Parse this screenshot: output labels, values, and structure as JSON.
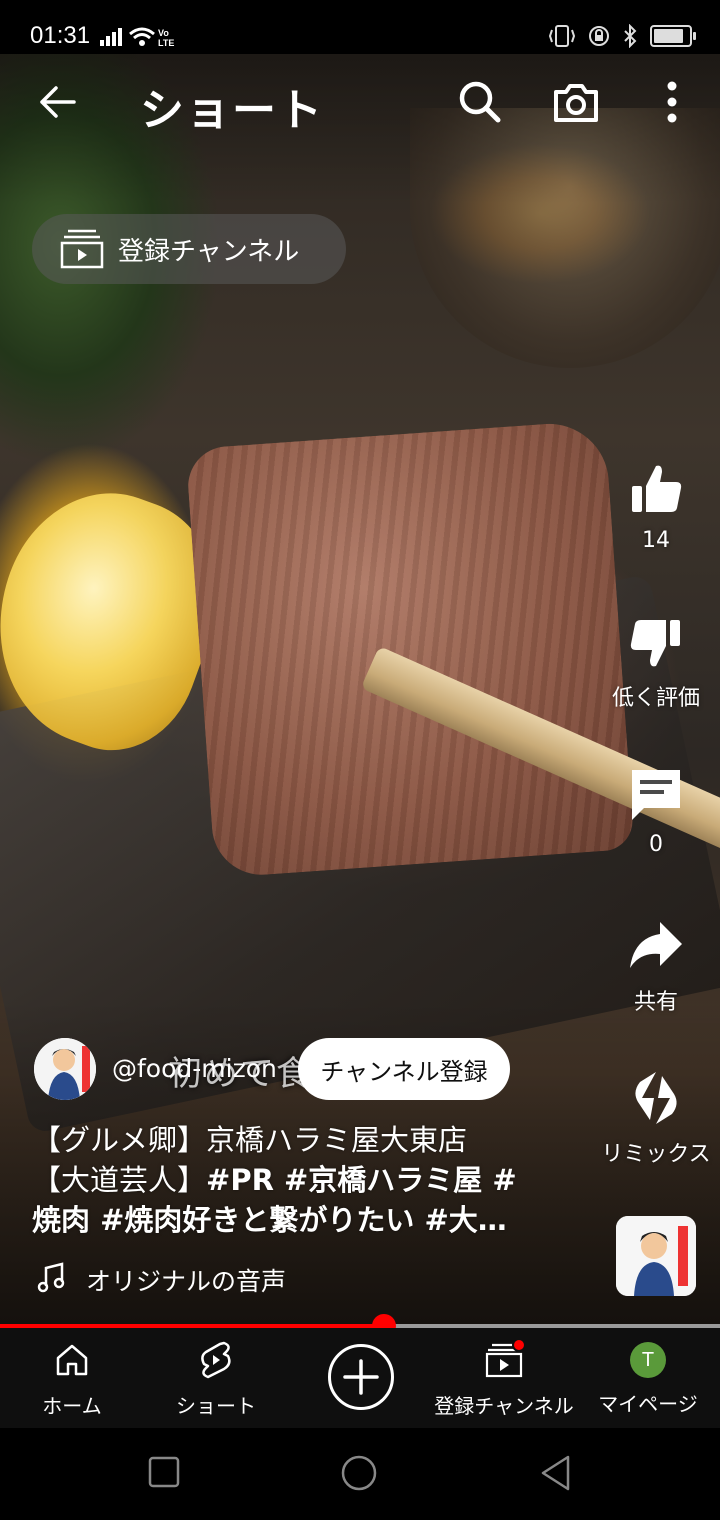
{
  "status_bar": {
    "time": "01:31",
    "network": "VoLTE"
  },
  "header": {
    "title": "ショート",
    "subscriptions_chip": "登録チャンネル"
  },
  "actions": {
    "like_count": "14",
    "dislike_label": "低く評価",
    "comment_count": "0",
    "share_label": "共有",
    "remix_label": "リミックス"
  },
  "video": {
    "subtitle_text": "初めて食べる"
  },
  "channel": {
    "handle": "@food-mizon",
    "subscribe_label": "チャンネル登録"
  },
  "caption": {
    "line1": "【グルメ卿】京橋ハラミ屋大東店",
    "line2_plain": "【大道芸人】",
    "line2_tags": "#PR  #京橋ハラミ屋  #",
    "line3_tag1": "焼肉",
    "line3_rest": "  #焼肉好きと繋がりたい  #大…"
  },
  "audio": {
    "label": "オリジナルの音声"
  },
  "progress": {
    "fraction": 0.533
  },
  "bottom_nav": {
    "home": "ホーム",
    "shorts": "ショート",
    "subscriptions": "登録チャンネル",
    "me": "マイページ",
    "me_initial": "T"
  },
  "colors": {
    "accent_red": "#ff0000",
    "nav_bg": "#0f0f0f",
    "avatar_green": "#5a9a3a"
  }
}
